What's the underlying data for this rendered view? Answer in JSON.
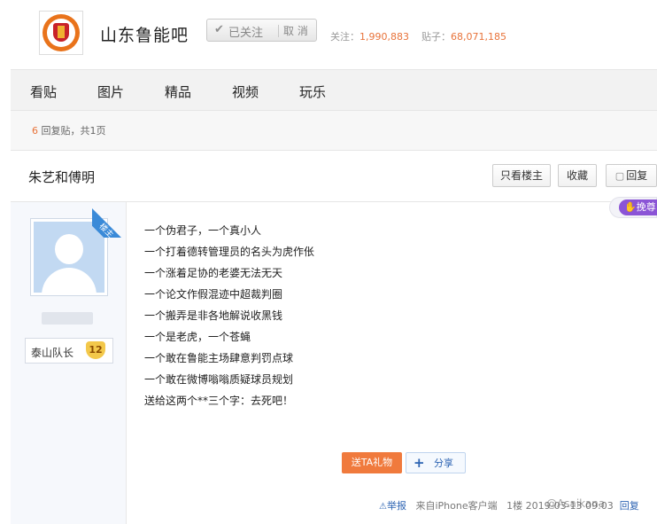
{
  "forum": {
    "name": "山东鲁能吧",
    "follow_check": "✔",
    "followed_label": "已关注",
    "cancel_label": "取 消",
    "followers_label": "关注：",
    "followers_value": "1,990,883",
    "posts_label": "贴子：",
    "posts_value": "68,071,185"
  },
  "nav": {
    "tabs": [
      "看贴",
      "图片",
      "精品",
      "视频",
      "玩乐"
    ]
  },
  "info": {
    "reply_count": "6",
    "reply_suffix": " 回复贴，共1页"
  },
  "thread": {
    "title": "朱艺和傅明",
    "only_op_label": "只看楼主",
    "favorite_label": "收藏",
    "reply_label": "回复",
    "tag_label": "挽尊"
  },
  "author": {
    "level_name": "泰山队长",
    "level": "12",
    "op_ribbon": "楼主"
  },
  "post": {
    "lines": [
      "一个伪君子，一个真小人",
      "一个打着德转管理员的名头为虎作伥",
      "一个涨着足协的老婆无法无天",
      "一个论文作假混迹中超裁判圈",
      "一个搬弄是非各地解说收黑钱",
      "一个是老虎，一个苍蝇",
      "一个敢在鲁能主场肆意判罚点球",
      "一个敢在微博嗡嗡质疑球员规划",
      "送给这两个**三个字：去死吧！"
    ],
    "gift_label": "送TA礼物",
    "share_label": "分享",
    "report_label": "举报",
    "source": "来自iPhone客户端",
    "floor": "1楼",
    "date": "2019-03-13 09:03",
    "reply_link": "回复",
    "watermark": "@Asaikana"
  },
  "colors": {
    "accent_orange": "#e8733a",
    "link_blue": "#2d64b3",
    "ribbon_blue": "#3a8ad8"
  }
}
